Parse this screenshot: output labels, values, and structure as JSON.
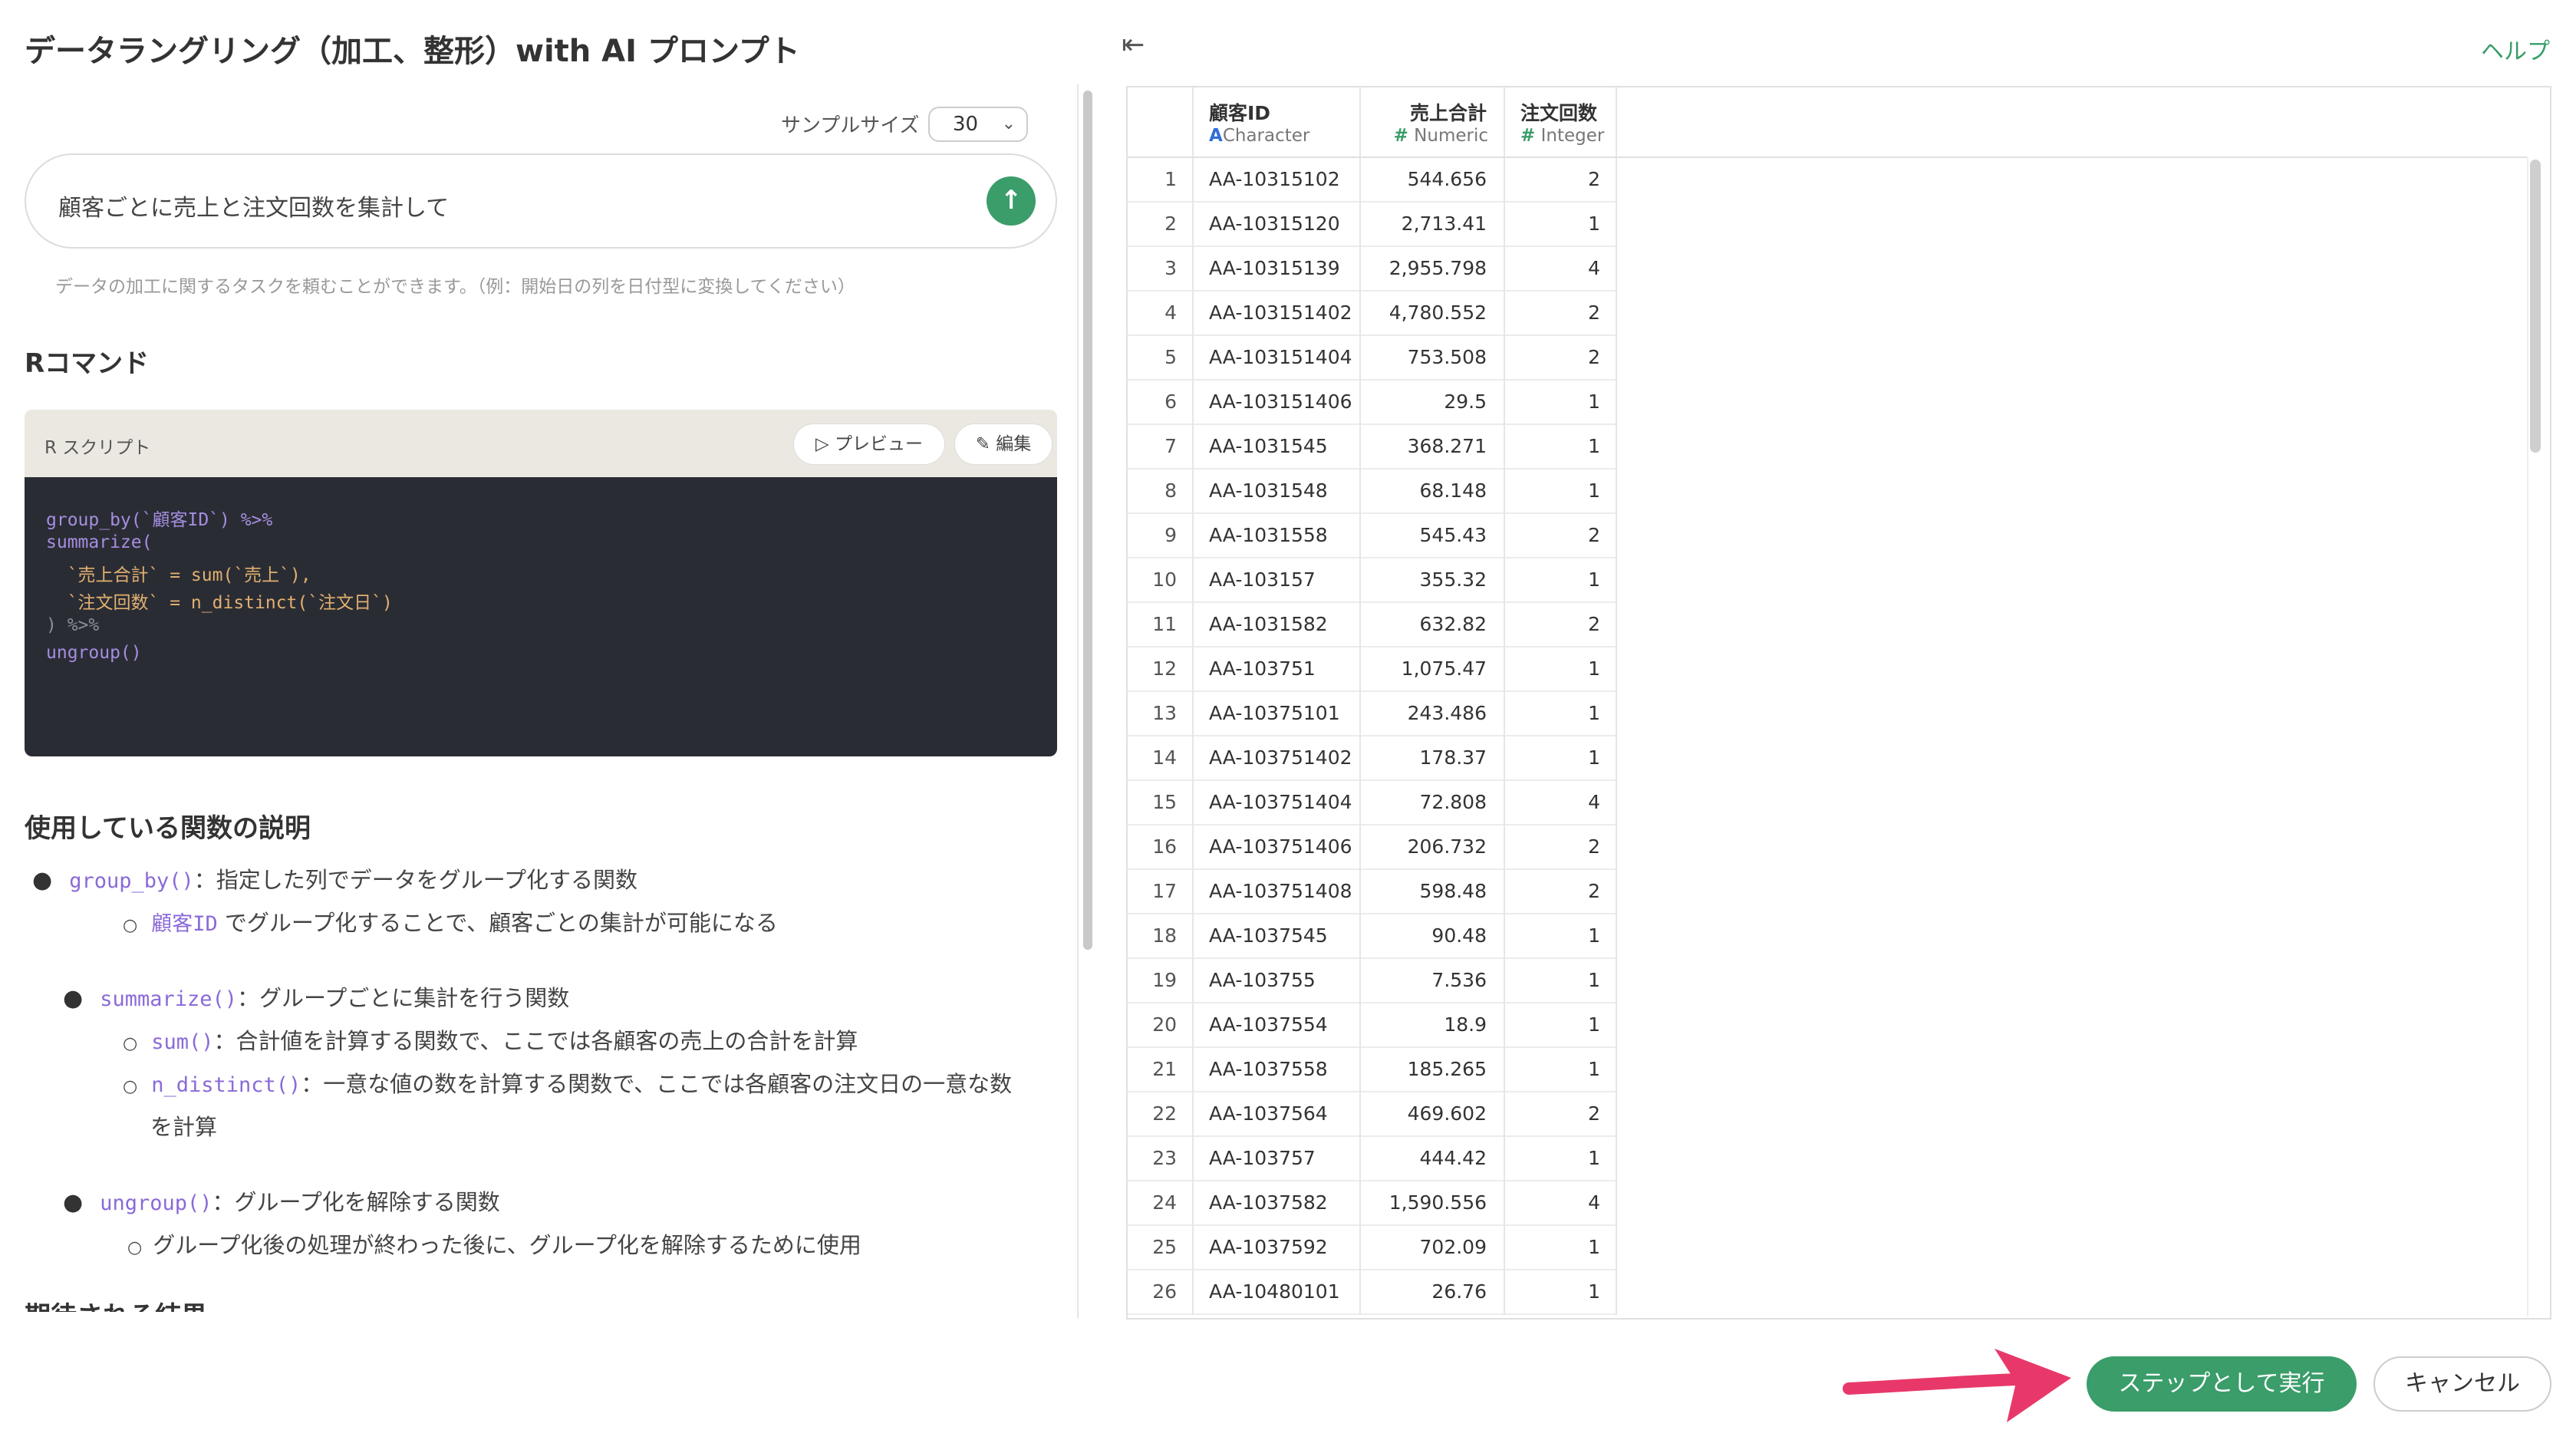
{
  "header": {
    "title": "データラングリング（加工、整形）with AI プロンプト",
    "help_label": "ヘルプ"
  },
  "sample": {
    "label": "サンプルサイズ",
    "value": "30"
  },
  "prompt": {
    "text": "顧客ごとに売上と注文回数を集計して",
    "hint": "データの加工に関するタスクを頼むことができます。（例：開始日の列を日付型に変換してください）"
  },
  "rcommand": {
    "heading": "Rコマンド",
    "script_label": "R スクリプト",
    "preview_label": "プレビュー",
    "edit_label": "編集",
    "code_lines": [
      "group_by(`顧客ID`) %>%",
      "summarize(",
      "  `売上合計` = sum(`売上`),",
      "  `注文回数` = n_distinct(`注文日`)",
      ") %>%",
      "ungroup()"
    ]
  },
  "explanation": {
    "heading": "使用している関数の説明",
    "items": [
      {
        "code": "group_by()",
        "text": "：指定した列でデータをグループ化する関数",
        "subs": [
          {
            "code": "顧客ID",
            "text": " でグループ化することで、顧客ごとの集計が可能になる"
          }
        ]
      },
      {
        "code": "summarize()",
        "text": "：グループごとに集計を行う関数",
        "subs": [
          {
            "code": "sum()",
            "text": "：合計値を計算する関数で、ここでは各顧客の売上の合計を計算"
          },
          {
            "code": "n_distinct()",
            "text": "：一意な値の数を計算する関数で、ここでは各顧客の注文日の一意な数",
            "text2": "を計算"
          }
        ]
      },
      {
        "code": "ungroup()",
        "text": "：グループ化を解除する関数",
        "subs": [
          {
            "code": "",
            "text": "グループ化後の処理が終わった後に、グループ化を解除するために使用"
          }
        ]
      }
    ],
    "cut_heading": "期待される結果"
  },
  "table": {
    "columns": [
      {
        "name": "顧客ID",
        "type": "Character",
        "type_icon": "A"
      },
      {
        "name": "売上合計",
        "type": "Numeric",
        "type_icon": "#"
      },
      {
        "name": "注文回数",
        "type": "Integer",
        "type_icon": "#"
      }
    ],
    "rows": [
      [
        "1",
        "AA-10315102",
        "544.656",
        "2"
      ],
      [
        "2",
        "AA-10315120",
        "2,713.41",
        "1"
      ],
      [
        "3",
        "AA-10315139",
        "2,955.798",
        "4"
      ],
      [
        "4",
        "AA-103151402",
        "4,780.552",
        "2"
      ],
      [
        "5",
        "AA-103151404",
        "753.508",
        "2"
      ],
      [
        "6",
        "AA-103151406",
        "29.5",
        "1"
      ],
      [
        "7",
        "AA-1031545",
        "368.271",
        "1"
      ],
      [
        "8",
        "AA-1031548",
        "68.148",
        "1"
      ],
      [
        "9",
        "AA-1031558",
        "545.43",
        "2"
      ],
      [
        "10",
        "AA-103157",
        "355.32",
        "1"
      ],
      [
        "11",
        "AA-1031582",
        "632.82",
        "2"
      ],
      [
        "12",
        "AA-103751",
        "1,075.47",
        "1"
      ],
      [
        "13",
        "AA-10375101",
        "243.486",
        "1"
      ],
      [
        "14",
        "AA-103751402",
        "178.37",
        "1"
      ],
      [
        "15",
        "AA-103751404",
        "72.808",
        "4"
      ],
      [
        "16",
        "AA-103751406",
        "206.732",
        "2"
      ],
      [
        "17",
        "AA-103751408",
        "598.48",
        "2"
      ],
      [
        "18",
        "AA-1037545",
        "90.48",
        "1"
      ],
      [
        "19",
        "AA-103755",
        "7.536",
        "1"
      ],
      [
        "20",
        "AA-1037554",
        "18.9",
        "1"
      ],
      [
        "21",
        "AA-1037558",
        "185.265",
        "1"
      ],
      [
        "22",
        "AA-1037564",
        "469.602",
        "2"
      ],
      [
        "23",
        "AA-103757",
        "444.42",
        "1"
      ],
      [
        "24",
        "AA-1037582",
        "1,590.556",
        "4"
      ],
      [
        "25",
        "AA-1037592",
        "702.09",
        "1"
      ],
      [
        "26",
        "AA-10480101",
        "26.76",
        "1"
      ]
    ]
  },
  "footer": {
    "run_label": "ステップとして実行",
    "cancel_label": "キャンセル"
  },
  "colors": {
    "accent": "#3a9d6a",
    "arrow": "#e8386a",
    "code_bg": "#2a2c34"
  }
}
